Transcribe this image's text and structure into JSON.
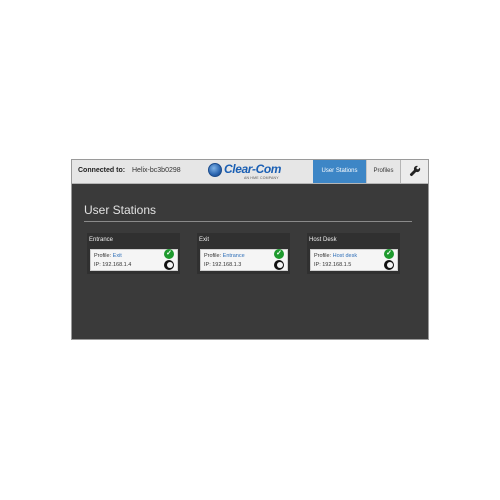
{
  "header": {
    "connected_label": "Connected to:",
    "connected_value": "Helix-bc3b0298",
    "logo_text": "Clear-Com",
    "logo_tagline": "AN HME COMPANY",
    "tabs": [
      {
        "label": "User Stations",
        "active": true
      },
      {
        "label": "Profiles",
        "active": false
      }
    ],
    "settings_icon": "wrench-icon"
  },
  "page_title": "User Stations",
  "stations": [
    {
      "name": "Entrance",
      "profile_label": "Profile:",
      "profile_value": "Exit",
      "ip": "IP: 192.168.1.4",
      "status_icon": "check-icon",
      "mode_icon": "moon-icon"
    },
    {
      "name": "Exit",
      "profile_label": "Profile:",
      "profile_value": "Entrance",
      "ip": "IP: 192.168.1.3",
      "status_icon": "check-icon",
      "mode_icon": "moon-icon"
    },
    {
      "name": "Host Desk",
      "profile_label": "Profile:",
      "profile_value": "Host desk",
      "ip": "IP: 192.168.1.5",
      "status_icon": "check-icon",
      "mode_icon": "moon-icon"
    }
  ],
  "colors": {
    "accent": "#3d86c6",
    "background": "#3a3a3a",
    "status_ok": "#1e9a2e",
    "link": "#2f6fb8"
  }
}
